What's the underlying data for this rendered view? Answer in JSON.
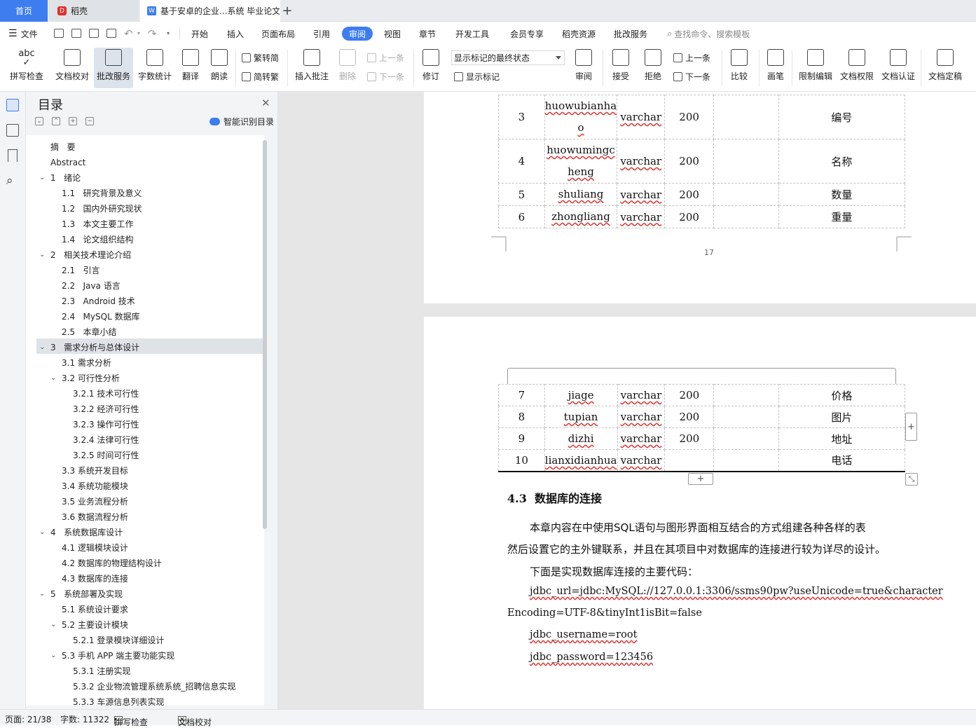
{
  "tabs": {
    "home": "首页",
    "daoke": "稻壳",
    "doc": "基于安卓的企业...系统 毕业论文"
  },
  "menu": {
    "file": "文件",
    "items": [
      "开始",
      "插入",
      "页面布局",
      "引用",
      "审阅",
      "视图",
      "章节",
      "开发工具",
      "会员专享",
      "稻壳资源",
      "批改服务"
    ],
    "search_placeholder": "查找命令、搜索模板"
  },
  "ribbon": {
    "spell_icon_text": "abc",
    "spell": "拼写检查",
    "proof": "文档校对",
    "batch": "批改服务",
    "wordcount": "字数统计",
    "translate": "翻译",
    "read": "朗读",
    "trad": "繁转简",
    "simp": "简转繁",
    "insert_comment": "插入批注",
    "delete": "删除",
    "prev": "上一条",
    "next": "下一条",
    "revise": "修订",
    "markup_state": "显示标记的最终状态",
    "show_markup": "显示标记",
    "review": "审阅",
    "accept": "接受",
    "reject": "拒绝",
    "prev2": "上一条",
    "next2": "下一条",
    "compare": "比较",
    "pen": "画笔",
    "restrict": "限制编辑",
    "rights": "文档权限",
    "cert": "文档认证",
    "final": "文档定稿"
  },
  "nav": {
    "title": "目录",
    "smart": "智能识别目录",
    "items": [
      {
        "num": "摘",
        "text": "要"
      },
      {
        "num": "Abstract",
        "text": ""
      },
      {
        "num": "1",
        "text": "绪论"
      },
      {
        "num": "1.1",
        "text": "研究背景及意义"
      },
      {
        "num": "1.2",
        "text": "国内外研究现状"
      },
      {
        "num": "1.3",
        "text": "本文主要工作"
      },
      {
        "num": "1.4",
        "text": "论文组织结构"
      },
      {
        "num": "2",
        "text": "相关技术理论介绍"
      },
      {
        "num": "2.1",
        "text": "引言"
      },
      {
        "num": "2.2",
        "text": "Java 语言"
      },
      {
        "num": "2.3",
        "text": "Android 技术"
      },
      {
        "num": "2.4",
        "text": "MySQL 数据库"
      },
      {
        "num": "2.5",
        "text": "本章小结"
      },
      {
        "num": "3",
        "text": "需求分析与总体设计"
      },
      {
        "num": "3.1",
        "text": "需求分析"
      },
      {
        "num": "3.2",
        "text": "可行性分析"
      },
      {
        "num": "3.2.1",
        "text": "技术可行性"
      },
      {
        "num": "3.2.2",
        "text": "经济可行性"
      },
      {
        "num": "3.2.3",
        "text": "操作可行性"
      },
      {
        "num": "3.2.4",
        "text": "法律可行性"
      },
      {
        "num": "3.2.5",
        "text": "时间可行性"
      },
      {
        "num": "3.3",
        "text": "系统开发目标"
      },
      {
        "num": "3.4",
        "text": "系统功能模块"
      },
      {
        "num": "3.5",
        "text": "业务流程分析"
      },
      {
        "num": "3.6",
        "text": "数据流程分析"
      },
      {
        "num": "4",
        "text": "系统数据库设计"
      },
      {
        "num": "4.1",
        "text": "逻辑模块设计"
      },
      {
        "num": "4.2",
        "text": "数据库的物理结构设计"
      },
      {
        "num": "4.3",
        "text": "数据库的连接"
      },
      {
        "num": "5",
        "text": "系统部署及实现"
      },
      {
        "num": "5.1",
        "text": "系统设计要求"
      },
      {
        "num": "5.2",
        "text": "主要设计模块"
      },
      {
        "num": "5.2.1",
        "text": "登录模块详细设计"
      },
      {
        "num": "5.3",
        "text": "手机 APP 端主要功能实现"
      },
      {
        "num": "5.3.1",
        "text": "注册实现"
      },
      {
        "num": "5.3.2",
        "text": "企业物流管理系统系统_招聘信息实现"
      },
      {
        "num": "5.3.3",
        "text": "车源信息列表实现"
      }
    ]
  },
  "table1": {
    "rows": [
      {
        "no": "3",
        "field_a": "huowubianha",
        "field_b": "o",
        "type": "varchar",
        "len": "200",
        "desc": "编号"
      },
      {
        "no": "4",
        "field_a": "huowumingc",
        "field_b": "heng",
        "type": "varchar",
        "len": "200",
        "desc": "名称"
      },
      {
        "no": "5",
        "field_a": "shuliang",
        "field_b": "",
        "type": "varchar",
        "len": "200",
        "desc": "数量"
      },
      {
        "no": "6",
        "field_a": "zhongliang",
        "field_b": "",
        "type": "varchar",
        "len": "200",
        "desc": "重量"
      }
    ]
  },
  "page_number": "17",
  "table2": {
    "rows": [
      {
        "no": "7",
        "field": "jiage",
        "type": "varchar",
        "len": "200",
        "desc": "价格"
      },
      {
        "no": "8",
        "field": "tupian",
        "type": "varchar",
        "len": "200",
        "desc": "图片"
      },
      {
        "no": "9",
        "field": "dizhi",
        "type": "varchar",
        "len": "200",
        "desc": "地址"
      },
      {
        "no": "10",
        "field": "lianxidianhua",
        "type": "varchar",
        "len": "",
        "desc": "电话"
      }
    ]
  },
  "section": {
    "num": "4.3",
    "title": "数据库的连接",
    "para1_line1": "本章内容在中使用SQL语句与图形界面相互结合的方式组建各种各样的表",
    "para1_line2": "然后设置它的主外键联系，并且在其项目中对数据库的连接进行较为详尽的设计。",
    "para2": "下面是实现数据库连接的主要代码：",
    "code1a": "jdbc_url=jdbc:MySQL://127.0.0.1:3306/ssms90pw?useUnicode=true&character",
    "code1b": "Encoding=UTF-8&tinyInt1isBit=false",
    "code2": "jdbc_username=root",
    "code3": "jdbc_password=123456"
  },
  "status": {
    "page": "页面: 21/38",
    "words": "字数: 11322",
    "spell": "拼写检查",
    "proof": "文档校对"
  },
  "icons": [
    "menu-icon",
    "save-icon",
    "print-icon",
    "undo-icon",
    "redo-icon",
    "search-icon",
    "close-icon",
    "outline-icon",
    "bookmark-icon",
    "plus-icon",
    "expand-icon"
  ]
}
